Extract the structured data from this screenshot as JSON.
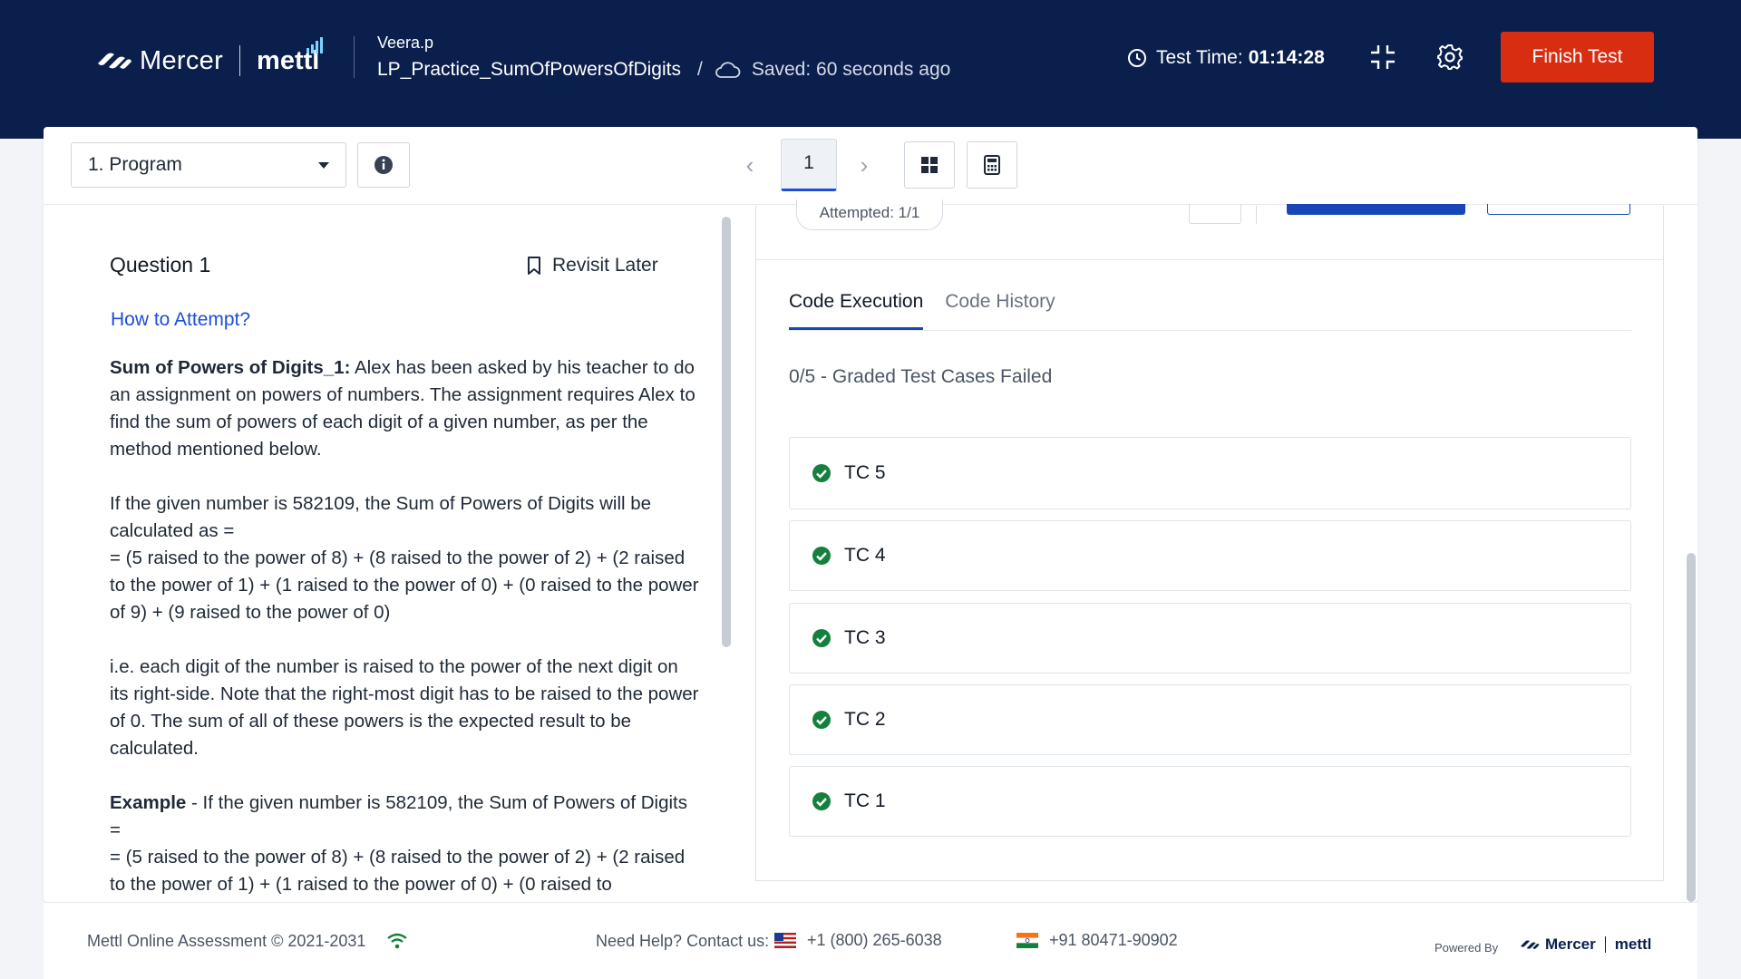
{
  "header": {
    "brand": {
      "mercer": "Mercer",
      "mettl": "mettl"
    },
    "user": "Veera.p",
    "test_name": "LP_Practice_SumOfPowersOfDigits",
    "separator": "/",
    "saved_status": "Saved: 60 seconds ago",
    "timer_label": "Test Time:",
    "timer_value": "01:14:28",
    "finish_label": "Finish Test"
  },
  "toolbar": {
    "section_select": "1. Program",
    "page_number": "1",
    "attempted": "Attempted: 1/1"
  },
  "question": {
    "title": "Question 1",
    "revisit_label": "Revisit Later",
    "how_to_attempt": "How to Attempt?",
    "p1_bold": "Sum of Powers of Digits_1:",
    "p1_text": " Alex has been asked by his teacher to do an assignment on powers of numbers. The assignment requires Alex to find the sum of powers of each digit of a given number, as per the method mentioned below.",
    "p2_line1": "If the given number is 582109, the Sum of Powers of Digits will be calculated as =",
    "p2_line2": "= (5 raised to the power of 8) + (8 raised to the power of 2) + (2 raised to the power of 1) + (1 raised to the power of 0) + (0 raised to the power of 9) + (9 raised to the power of 0)",
    "p3": "i.e. each digit of the number is raised to the power of the next digit on its right-side. Note that the right-most digit has to be raised to the power of 0. The sum of all of these powers is the expected result to be calculated.",
    "p4_bold": "Example",
    "p4_text": " - If the given number is 582109, the Sum of Powers of Digits =",
    "p4_line2": "= (5 raised to the power of 8) + (8 raised to the power of 2) + (2 raised to the power of 1) + (1 raised to the power of 0) + (0 raised to"
  },
  "results": {
    "tabs": [
      "Code Execution",
      "Code History"
    ],
    "summary": "0/5 - Graded Test Cases Failed",
    "test_cases": [
      "TC 5",
      "TC 4",
      "TC 3",
      "TC 2",
      "TC 1"
    ]
  },
  "footer": {
    "copyright": "Mettl Online Assessment © 2021-2031",
    "help": "Need Help? Contact us:",
    "phone_us": "+1 (800) 265-6038",
    "phone_in": "+91 80471-90902",
    "powered_by": "Powered By",
    "brand_mercer": "Mercer",
    "brand_mettl": "mettl"
  },
  "colors": {
    "header_bg": "#0b1f4d",
    "finish_button": "#d92d12",
    "accent": "#1746b8",
    "success": "#15803d"
  },
  "icons": [
    "mercer-logo-icon",
    "cloud-icon",
    "clock-icon",
    "collapse-icon",
    "gear-icon",
    "info-icon",
    "grid-icon",
    "calculator-icon",
    "bookmark-icon",
    "check-circle-icon",
    "wifi-icon",
    "us-flag-icon",
    "india-flag-icon"
  ]
}
